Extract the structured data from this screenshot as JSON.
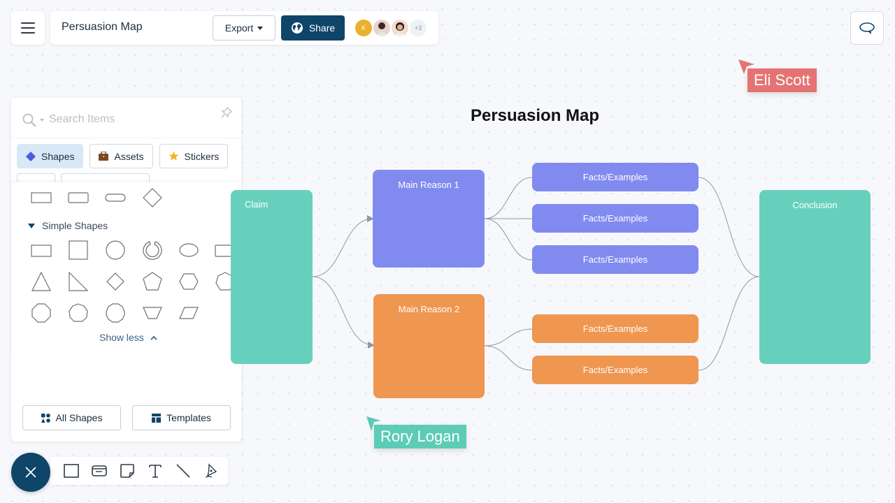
{
  "header": {
    "menu_icon": "hamburger-icon",
    "document_title": "Persuasion Map",
    "export_label": "Export",
    "share_label": "Share",
    "share_icon": "globe-icon",
    "collaborators": [
      {
        "initial": "K",
        "color": "#ebb02d"
      },
      {
        "initial": "",
        "color": "#e8d4cf"
      },
      {
        "initial": "",
        "color": "#f2ddd0"
      }
    ],
    "more_collaborators": "+3",
    "comment_icon": "speech-bubble-icon"
  },
  "panel": {
    "search_placeholder": "Search Items",
    "tabs": [
      {
        "label": "Shapes",
        "icon": "diamond-icon",
        "active": true
      },
      {
        "label": "Assets",
        "icon": "briefcase-icon",
        "active": false
      },
      {
        "label": "Stickers",
        "icon": "star-icon",
        "active": false
      }
    ],
    "basic_shapes": [
      "rectangle",
      "rounded-rectangle",
      "pill",
      "diamond"
    ],
    "section_title": "Simple Shapes",
    "simple_shapes": [
      "rectangle",
      "square",
      "circle",
      "donut",
      "ellipse",
      "wide-rectangle",
      "triangle",
      "right-triangle",
      "diamond",
      "pentagon",
      "hexagon",
      "heptagon",
      "octagon",
      "nonagon",
      "decagon",
      "trapezoid",
      "parallelogram"
    ],
    "show_less_label": "Show less",
    "all_shapes_label": "All Shapes",
    "templates_label": "Templates"
  },
  "toolbar": {
    "tools": [
      "rectangle-tool",
      "card-tool",
      "sticky-note-tool",
      "text-tool",
      "line-tool",
      "pen-tool"
    ]
  },
  "diagram": {
    "title": "Persuasion Map",
    "claim": "Claim",
    "reason1": "Main Reason 1",
    "reason2": "Main Reason 2",
    "facts1": [
      "Facts/Examples",
      "Facts/Examples",
      "Facts/Examples"
    ],
    "facts2": [
      "Facts/Examples",
      "Facts/Examples"
    ],
    "conclusion": "Conclusion",
    "colors": {
      "claim": "#67d0bd",
      "reason1": "#818bef",
      "reason2": "#ef9650",
      "conclusion": "#67d0bd",
      "connector": "#8e96a3"
    }
  },
  "cursors": [
    {
      "name": "Eli Scott",
      "color": "#e57373"
    },
    {
      "name": "Rory Logan",
      "color": "#5cccb6"
    }
  ]
}
